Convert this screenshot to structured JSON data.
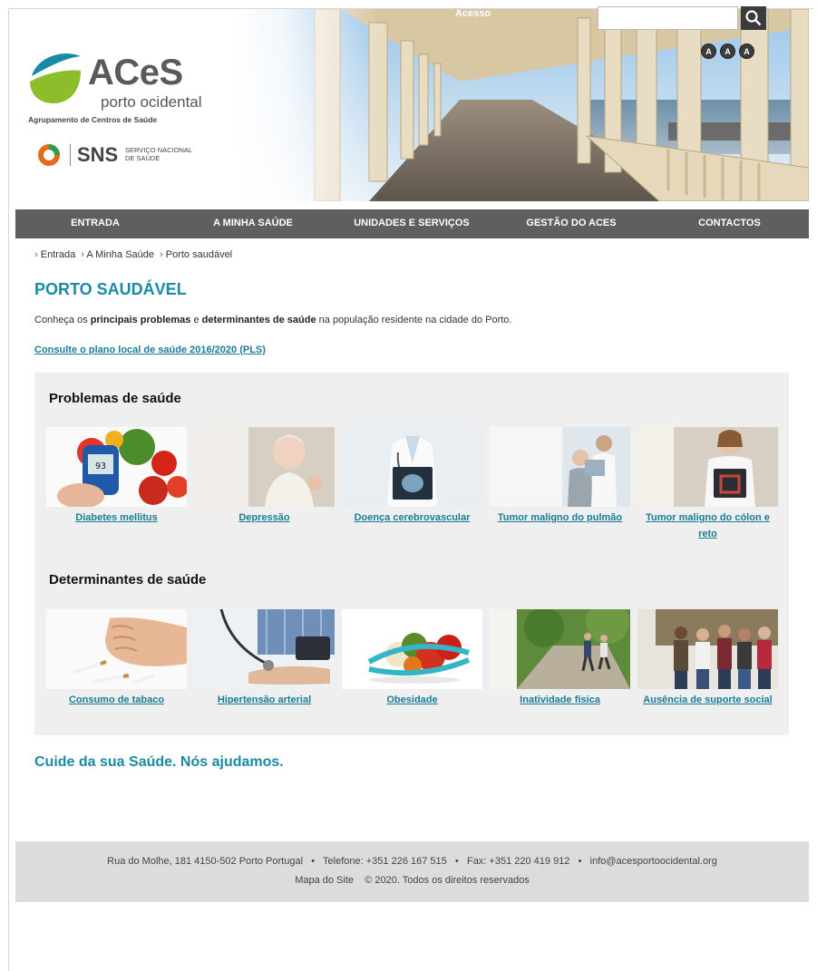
{
  "header": {
    "brand": "ACeS",
    "brand_sub": "porto ocidental",
    "brand_tagline": "Agrupamento de Centros de Saúde",
    "sns_name": "SNS",
    "sns_sub_line1": "SERVIÇO NACIONAL",
    "sns_sub_line2": "DE SAÚDE",
    "acesso_link": "Acesso",
    "search": {
      "value": "",
      "placeholder": ""
    },
    "font_sizes": [
      "A",
      "A",
      "A"
    ]
  },
  "nav": [
    {
      "label": "ENTRADA"
    },
    {
      "label": "A MINHA SAÚDE"
    },
    {
      "label": "UNIDADES E SERVIÇOS"
    },
    {
      "label": "GESTÃO DO ACES"
    },
    {
      "label": "CONTACTOS"
    }
  ],
  "breadcrumb": [
    "Entrada",
    "A Minha Saúde",
    "Porto saudável"
  ],
  "page": {
    "title": "PORTO SAUDÁVEL",
    "intro_pre": "Conheça os ",
    "intro_bold1": "principais problemas",
    "intro_mid": " e ",
    "intro_bold2": "determinantes de saúde",
    "intro_post": " na população residente na cidade do Porto.",
    "pls_link": "Consulte o plano local de saúde 2016/2020 (PLS)",
    "tagline": "Cuide da sua Saúde. Nós ajudamos."
  },
  "problemas": {
    "title": "Problemas de saúde",
    "items": [
      {
        "label": "Diabetes mellitus",
        "icon": "diabetes-image"
      },
      {
        "label": "Depressão",
        "icon": "depression-image"
      },
      {
        "label": "Doença cerebrovascular",
        "icon": "cerebrovascular-image"
      },
      {
        "label": "Tumor maligno do pulmão",
        "icon": "lung-cancer-image"
      },
      {
        "label": "Tumor maligno do cólon e reto",
        "icon": "colon-cancer-image"
      }
    ]
  },
  "determinantes": {
    "title": "Determinantes de saúde",
    "items": [
      {
        "label": "Consumo de tabaco",
        "icon": "tobacco-image"
      },
      {
        "label": "Hipertensão arterial",
        "icon": "hypertension-image"
      },
      {
        "label": "Obesidade",
        "icon": "obesity-image"
      },
      {
        "label": "Inatividade física",
        "icon": "inactivity-image"
      },
      {
        "label": "Ausência de suporte social",
        "icon": "social-support-image"
      }
    ]
  },
  "footer": {
    "address": "Rua do Molhe, 181   4150-502   Porto   Portugal",
    "phone": "Telefone: +351 226 167 515",
    "fax": "Fax: +351 220 419 912",
    "email": "info@acesportoocidental.org",
    "sitemap": "Mapa do Site",
    "copyright": "© 2020. Todos os direitos reservados",
    "separator": "•"
  },
  "colors": {
    "accent": "#1a8aa5",
    "nav_bg": "#5f5f5f",
    "panel_bg": "#efefef",
    "footer_bg": "#dcdcdc"
  }
}
